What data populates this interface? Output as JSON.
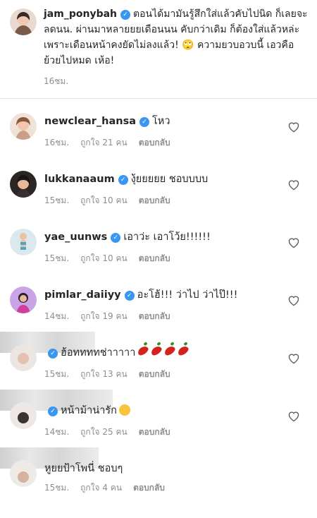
{
  "caption": {
    "username": "jam_ponybah",
    "text": "ตอนได้มามันรู้สึกใส่แล้วคับไปนิด ก็เลยจะลดนน. ผ่านมาหลายยยเดือนนน คับกว่าเดิม ก็ต้องใส่แล้วหล่ะ เพราะเดือนหน้าคงยัดไม่ลงแล้ว! 🙄 ความยวบอวบนี้ เอวคือย้วยไปหมด เห้อ!",
    "time": "16ชม."
  },
  "comments": [
    {
      "username": "newclear_hansa",
      "text": "โหว",
      "time": "16ชม.",
      "likes": "ถูกใจ 21 คน",
      "reply": "ตอบกลับ"
    },
    {
      "username": "lukkanaaum",
      "text": "งุ้ยยยยย ชอบบบบ",
      "time": "15ชม.",
      "likes": "ถูกใจ 10 คน",
      "reply": "ตอบกลับ"
    },
    {
      "username": "yae_uunws",
      "text": "เอาว่ะ เอาโว้ย!!!!!!",
      "time": "15ชม.",
      "likes": "ถูกใจ 10 คน",
      "reply": "ตอบกลับ"
    },
    {
      "username": "pimlar_daiiyy",
      "text": "อะโฮ้!!! ว่าไป ว่าไป๊!!!",
      "time": "14ชม.",
      "likes": "ถูกใจ 19 คน",
      "reply": "ตอบกลับ"
    },
    {
      "username": "",
      "text": "ฮ้อททททช่าาาาา",
      "time": "15ชม.",
      "likes": "ถูกใจ 13 คน",
      "reply": "ตอบกลับ"
    },
    {
      "username": "",
      "text": "หน้าม้าน่ารัก",
      "time": "14ชม.",
      "likes": "ถูกใจ 25 คน",
      "reply": "ตอบกลับ"
    },
    {
      "username": "",
      "text": "หูยยป้าโพนี่ ชอบๆ",
      "time": "15ชม.",
      "likes": "ถูกใจ 4 คน",
      "reply": "ตอบกลับ"
    }
  ],
  "colors": {
    "verified": "#3897f0",
    "meta": "#8e8e8e",
    "text": "#262626"
  },
  "icons": {
    "verified": "verified-badge-icon",
    "like": "heart-outline-icon"
  }
}
